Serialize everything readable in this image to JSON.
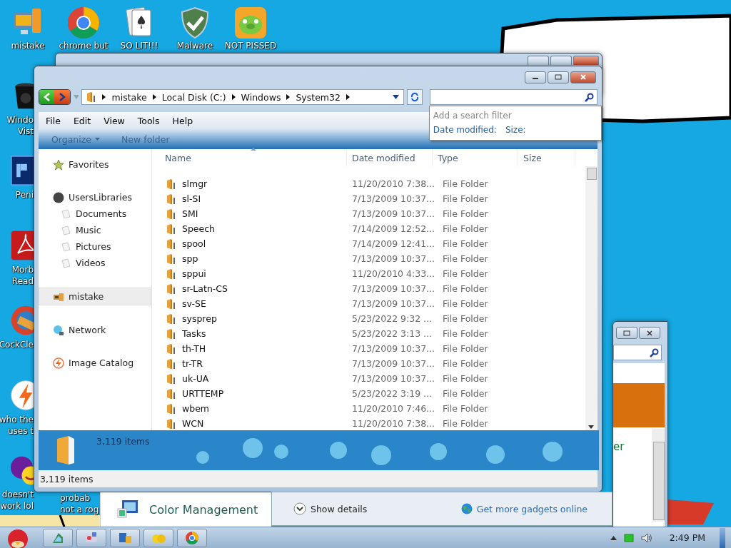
{
  "desktop_icons_top": [
    {
      "label": "mistake",
      "kind": "computer"
    },
    {
      "label": "chrome but",
      "kind": "chrome"
    },
    {
      "label": "SO LIT!!!",
      "kind": "cards"
    },
    {
      "label": "Malware",
      "kind": "shield"
    },
    {
      "label": "NOT PISSED",
      "kind": "pig"
    }
  ],
  "desktop_icons_left": [
    {
      "lines": [
        "Windo",
        "Vist"
      ],
      "kind": "trash"
    },
    {
      "lines": [
        "Peni"
      ],
      "kind": "ps"
    },
    {
      "lines": [
        "Morb",
        "Read"
      ],
      "kind": "pdf"
    },
    {
      "lines": [
        "CockCle"
      ],
      "kind": "cleaner"
    },
    {
      "lines": [
        "who the",
        "uses t"
      ],
      "kind": "bolt"
    },
    {
      "lines": [
        "doesn't",
        "work lol"
      ],
      "kind": "yahoo"
    }
  ],
  "desktop_label_partial": {
    "lines": [
      "probab",
      "not a rog"
    ]
  },
  "explorer": {
    "breadcrumb": [
      "mistake",
      "Local Disk (C:)",
      "Windows",
      "System32"
    ],
    "menu": [
      "File",
      "Edit",
      "View",
      "Tools",
      "Help"
    ],
    "toolbar": [
      "Organize",
      "New folder"
    ],
    "search_dropdown": {
      "hint": "Add a search filter",
      "filters": [
        "Date modified:",
        "Size:"
      ]
    },
    "sidebar": [
      {
        "label": "Favorites",
        "kind": "star",
        "selected": false
      },
      {
        "label": "UsersLibraries",
        "kind": "disc",
        "selected": false,
        "children": [
          {
            "label": "Documents",
            "kind": "doc",
            "selected": false
          },
          {
            "label": "Music",
            "kind": "doc",
            "selected": false
          },
          {
            "label": "Pictures",
            "kind": "doc",
            "selected": false
          },
          {
            "label": "Videos",
            "kind": "doc",
            "selected": false
          }
        ]
      },
      {
        "label": "mistake",
        "kind": "computer",
        "selected": true
      },
      {
        "label": "Network",
        "kind": "network",
        "selected": false
      },
      {
        "label": "Image Catalog",
        "kind": "bolt",
        "selected": false
      }
    ],
    "columns": [
      "Name",
      "Date modified",
      "Type",
      "Size"
    ],
    "rows": [
      {
        "name": "slmgr",
        "date": "11/20/2010 7:38...",
        "type": "File Folder"
      },
      {
        "name": "sl-SI",
        "date": "7/13/2009 10:37...",
        "type": "File Folder"
      },
      {
        "name": "SMI",
        "date": "7/13/2009 10:37...",
        "type": "File Folder"
      },
      {
        "name": "Speech",
        "date": "7/14/2009 12:52...",
        "type": "File Folder"
      },
      {
        "name": "spool",
        "date": "7/14/2009 12:41...",
        "type": "File Folder"
      },
      {
        "name": "spp",
        "date": "7/13/2009 10:37...",
        "type": "File Folder"
      },
      {
        "name": "sppui",
        "date": "11/20/2010 4:33...",
        "type": "File Folder"
      },
      {
        "name": "sr-Latn-CS",
        "date": "7/13/2009 10:37...",
        "type": "File Folder"
      },
      {
        "name": "sv-SE",
        "date": "7/13/2009 10:37...",
        "type": "File Folder"
      },
      {
        "name": "sysprep",
        "date": "5/23/2022 9:32 ...",
        "type": "File Folder"
      },
      {
        "name": "Tasks",
        "date": "5/23/2022 3:13 ...",
        "type": "File Folder"
      },
      {
        "name": "th-TH",
        "date": "7/13/2009 10:37...",
        "type": "File Folder"
      },
      {
        "name": "tr-TR",
        "date": "7/13/2009 10:37...",
        "type": "File Folder"
      },
      {
        "name": "uk-UA",
        "date": "7/13/2009 10:37...",
        "type": "File Folder"
      },
      {
        "name": "URTTEMP",
        "date": "5/23/2022 3:19 ...",
        "type": "File Folder"
      },
      {
        "name": "wbem",
        "date": "11/20/2010 7:46...",
        "type": "File Folder"
      },
      {
        "name": "WCN",
        "date": "11/20/2010 7:38...",
        "type": "File Folder"
      }
    ],
    "details_count": "3,119 items",
    "status": "3,119 items"
  },
  "color_window": {
    "title": "Color Management"
  },
  "gadgets_window": {
    "show_details": "Show details",
    "link": "Get more gadgets online"
  },
  "back_window": {
    "text": "er"
  },
  "taskbar": {
    "buttons": [
      {
        "kind": "building"
      },
      {
        "kind": "paint"
      },
      {
        "kind": "windows"
      },
      {
        "kind": "yellow"
      },
      {
        "kind": "chrome"
      }
    ],
    "clock": "2:49 PM"
  }
}
